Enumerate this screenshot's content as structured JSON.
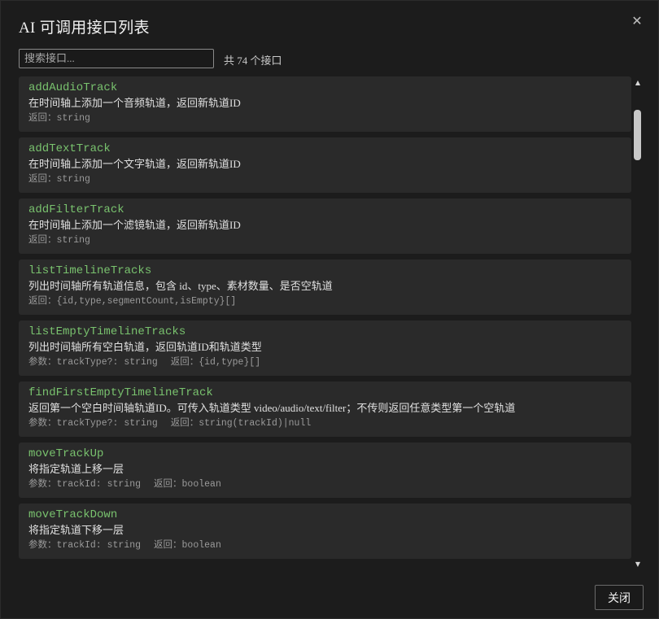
{
  "dialog": {
    "title": "AI 可调用接口列表",
    "close_label": "关闭",
    "close_glyph": "✕"
  },
  "search": {
    "placeholder": "搜索接口...",
    "value": ""
  },
  "count_label": "共 74 个接口",
  "labels": {
    "params": "参数：",
    "returns": "返回："
  },
  "apis": [
    {
      "name": "addAudioTrack",
      "desc": "在时间轴上添加一个音频轨道，返回新轨道ID",
      "params": "",
      "returns": "string"
    },
    {
      "name": "addTextTrack",
      "desc": "在时间轴上添加一个文字轨道，返回新轨道ID",
      "params": "",
      "returns": "string"
    },
    {
      "name": "addFilterTrack",
      "desc": "在时间轴上添加一个滤镜轨道，返回新轨道ID",
      "params": "",
      "returns": "string"
    },
    {
      "name": "listTimelineTracks",
      "desc": "列出时间轴所有轨道信息，包含 id、type、素材数量、是否空轨道",
      "params": "",
      "returns": "{id,type,segmentCount,isEmpty}[]"
    },
    {
      "name": "listEmptyTimelineTracks",
      "desc": "列出时间轴所有空白轨道，返回轨道ID和轨道类型",
      "params": "trackType?: string",
      "returns": "{id,type}[]"
    },
    {
      "name": "findFirstEmptyTimelineTrack",
      "desc": "返回第一个空白时间轴轨道ID。可传入轨道类型 video/audio/text/filter；不传则返回任意类型第一个空轨道",
      "params": "trackType?: string",
      "returns": "string(trackId)|null"
    },
    {
      "name": "moveTrackUp",
      "desc": "将指定轨道上移一层",
      "params": "trackId: string",
      "returns": "boolean"
    },
    {
      "name": "moveTrackDown",
      "desc": "将指定轨道下移一层",
      "params": "trackId: string",
      "returns": "boolean"
    }
  ],
  "scrollbar": {
    "up_glyph": "▲",
    "down_glyph": "▼"
  }
}
